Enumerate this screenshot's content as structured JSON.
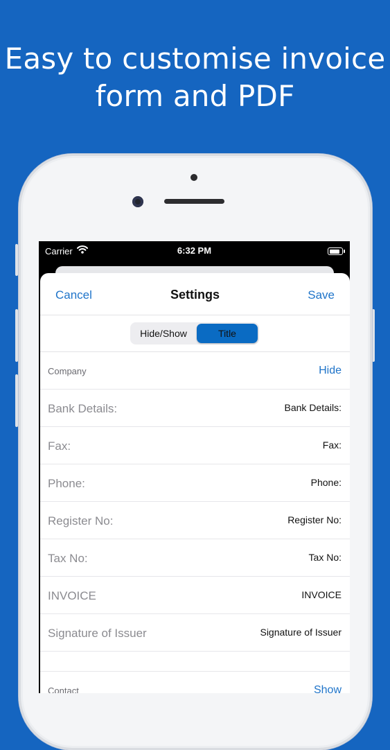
{
  "headline": {
    "line1": "Easy to customise invoice",
    "line2": "form and PDF"
  },
  "status_bar": {
    "carrier": "Carrier",
    "time": "6:32 PM",
    "icons": [
      "wifi-icon",
      "battery-icon"
    ]
  },
  "nav": {
    "cancel": "Cancel",
    "title": "Settings",
    "save": "Save"
  },
  "segment": {
    "options": [
      "Hide/Show",
      "Title"
    ],
    "selected": "Title"
  },
  "company": {
    "header": "Company",
    "action": "Hide",
    "rows": [
      {
        "label": "Bank Details:",
        "value": "Bank Details:"
      },
      {
        "label": "Fax:",
        "value": "Fax:"
      },
      {
        "label": "Phone:",
        "value": "Phone:"
      },
      {
        "label": "Register No:",
        "value": "Register No:"
      },
      {
        "label": "Tax No:",
        "value": "Tax No:"
      },
      {
        "label": "INVOICE",
        "value": "INVOICE"
      },
      {
        "label": "Signature of Issuer",
        "value": "Signature of Issuer"
      }
    ]
  },
  "contact": {
    "header": "Contact",
    "action": "Show"
  },
  "colors": {
    "background": "#1565c0",
    "accent": "#1f74c9",
    "segment_selected": "#0a6bc3"
  }
}
